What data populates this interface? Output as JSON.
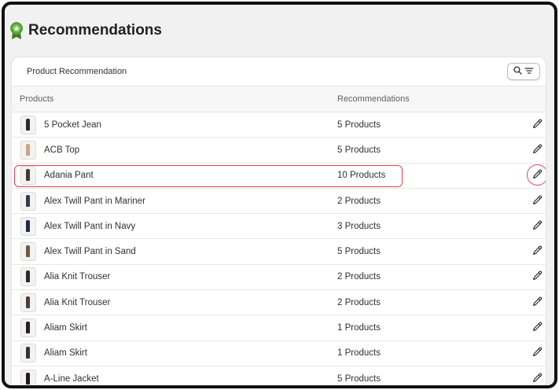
{
  "page": {
    "title": "Recommendations",
    "logo_icon": "award-ribbon-icon",
    "accent_color": "#5a9e3e",
    "highlight_color": "#e0454d"
  },
  "card": {
    "title": "Product Recommendation",
    "filter_icons": [
      "search-icon",
      "filter-lines-icon"
    ]
  },
  "table": {
    "columns": [
      "Products",
      "Recommendations"
    ],
    "edit_icon": "pencil-icon",
    "rows": [
      {
        "product": "5 Pocket Jean",
        "recommendations": "5 Products",
        "thumb_color": "#2b2b2b",
        "highlighted": false
      },
      {
        "product": "ACB Top",
        "recommendations": "5 Products",
        "thumb_color": "#c9a48a",
        "highlighted": false
      },
      {
        "product": "Adania Pant",
        "recommendations": "10 Products",
        "thumb_color": "#3a3a3a",
        "highlighted": true
      },
      {
        "product": "Alex Twill Pant in Mariner",
        "recommendations": "2 Products",
        "thumb_color": "#2f3b4a",
        "highlighted": false
      },
      {
        "product": "Alex Twill Pant in Navy",
        "recommendations": "3 Products",
        "thumb_color": "#1f2a44",
        "highlighted": false
      },
      {
        "product": "Alex Twill Pant in Sand",
        "recommendations": "5 Products",
        "thumb_color": "#6b5b4b",
        "highlighted": false
      },
      {
        "product": "Alia Knit Trouser",
        "recommendations": "2 Products",
        "thumb_color": "#2a2a2a",
        "highlighted": false
      },
      {
        "product": "Alia Knit Trouser",
        "recommendations": "2 Products",
        "thumb_color": "#4a3e38",
        "highlighted": false
      },
      {
        "product": "Aliam Skirt",
        "recommendations": "1 Products",
        "thumb_color": "#222222",
        "highlighted": false
      },
      {
        "product": "Aliam Skirt",
        "recommendations": "1 Products",
        "thumb_color": "#333333",
        "highlighted": false
      },
      {
        "product": "A-Line Jacket",
        "recommendations": "5 Products",
        "thumb_color": "#1c1c1c",
        "highlighted": false
      }
    ]
  }
}
